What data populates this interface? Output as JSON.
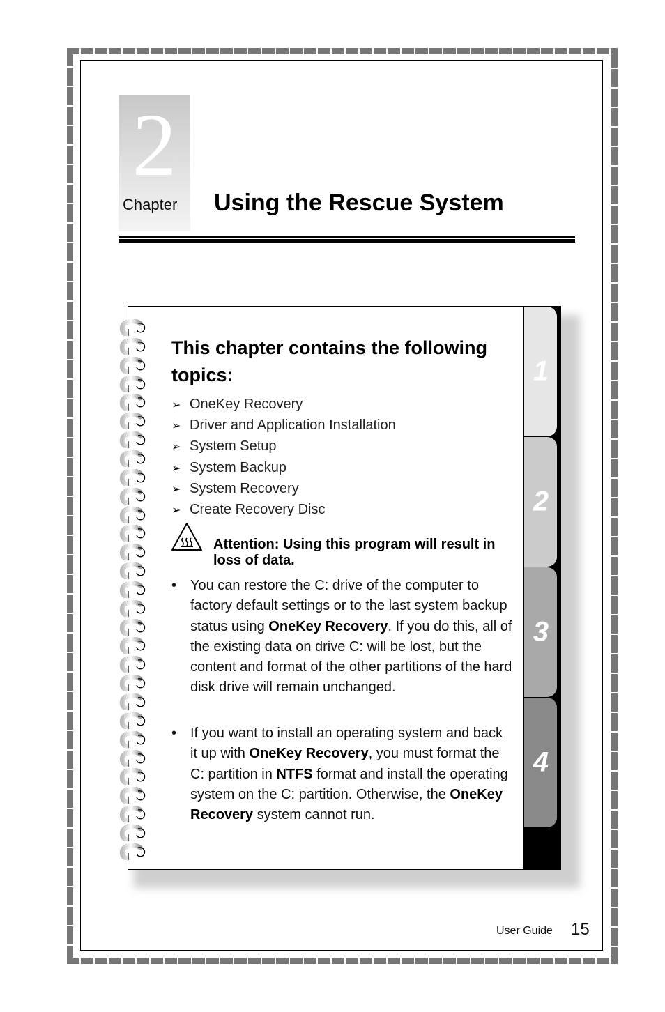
{
  "chapter": {
    "number": "2",
    "label": "Chapter",
    "title": "Using the Rescue System"
  },
  "card": {
    "heading": "This chapter contains the following topics:",
    "topic_bullet_icon": "arrowhead-bullet",
    "topics": [
      "OneKey Recovery",
      "Driver and Application Installation",
      "System Setup",
      "System Backup",
      "System Recovery",
      "Create Recovery Disc"
    ],
    "attention": {
      "icon": "hot-surface-warning-triangle",
      "text": "Attention: Using this program will result in loss of data."
    },
    "paragraphs": [
      {
        "bullet": "•",
        "parts": [
          {
            "text": "You can restore the C: drive of the computer to factory default settings or to the last system backup status using ",
            "bold": false
          },
          {
            "text": "OneKey Recovery",
            "bold": true
          },
          {
            "text": ". If you do this, all of the existing data on drive C: will be lost, but the content and format of the other partitions of the hard disk drive will remain unchanged.",
            "bold": false
          }
        ]
      },
      {
        "bullet": "•",
        "parts": [
          {
            "text": "If you want to install an operating system and back it up with ",
            "bold": false
          },
          {
            "text": "OneKey Recovery",
            "bold": true
          },
          {
            "text": ", you must format the C: partition in ",
            "bold": false
          },
          {
            "text": "NTFS",
            "bold": true
          },
          {
            "text": " format and install the operating system on the C: partition. Otherwise, the ",
            "bold": false
          },
          {
            "text": "OneKey Recovery",
            "bold": true
          },
          {
            "text": " system cannot run.",
            "bold": false
          }
        ]
      }
    ],
    "tabs": [
      {
        "label": "1",
        "color": "#e6e6e6"
      },
      {
        "label": "2",
        "color": "#cbcbcb"
      },
      {
        "label": "3",
        "color": "#a9a9a9"
      },
      {
        "label": "4",
        "color": "#8a8a8a"
      }
    ],
    "spiral_ring_count": 29
  },
  "footer": {
    "label": "User Guide",
    "page_number": "15"
  }
}
